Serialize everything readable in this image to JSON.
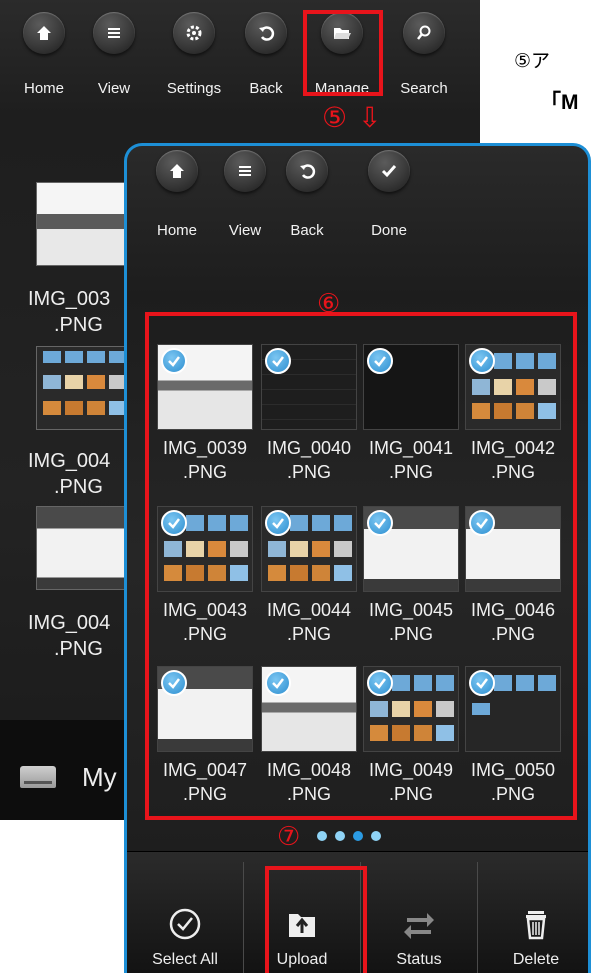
{
  "back_screen": {
    "toolbar": [
      {
        "label": "Home",
        "icon": "home-icon"
      },
      {
        "label": "View",
        "icon": "list-icon"
      },
      {
        "label": "Settings",
        "icon": "gear-icon"
      },
      {
        "label": "Back",
        "icon": "back-arrow-icon"
      },
      {
        "label": "Manage",
        "icon": "folder-open-icon"
      },
      {
        "label": "Search",
        "icon": "search-icon"
      }
    ],
    "files": [
      {
        "line1": "IMG_003",
        "line2": ".PNG"
      },
      {
        "line1": "IMG_004",
        "line2": ".PNG"
      },
      {
        "line1": "IMG_004",
        "line2": ".PNG"
      }
    ],
    "bottom_label": "My"
  },
  "annotations": {
    "right_line1": "⑤ア",
    "right_line2": "「M",
    "step5": "⑤",
    "step5_arrow": "⇩",
    "step6": "⑥",
    "step7": "⑦",
    "highlight_color": "#e8141b"
  },
  "front_screen": {
    "toolbar": [
      {
        "label": "Home",
        "icon": "home-icon"
      },
      {
        "label": "View",
        "icon": "list-icon"
      },
      {
        "label": "Back",
        "icon": "back-arrow-icon"
      },
      {
        "label": "Done",
        "icon": "checkmark-icon"
      }
    ],
    "files": [
      {
        "line1": "IMG_0039",
        "line2": ".PNG",
        "checked": true
      },
      {
        "line1": "IMG_0040",
        "line2": ".PNG",
        "checked": true
      },
      {
        "line1": "IMG_0041",
        "line2": ".PNG",
        "checked": true
      },
      {
        "line1": "IMG_0042",
        "line2": ".PNG",
        "checked": true
      },
      {
        "line1": "IMG_0043",
        "line2": ".PNG",
        "checked": true
      },
      {
        "line1": "IMG_0044",
        "line2": ".PNG",
        "checked": true
      },
      {
        "line1": "IMG_0045",
        "line2": ".PNG",
        "checked": true
      },
      {
        "line1": "IMG_0046",
        "line2": ".PNG",
        "checked": true
      },
      {
        "line1": "IMG_0047",
        "line2": ".PNG",
        "checked": true
      },
      {
        "line1": "IMG_0048",
        "line2": ".PNG",
        "checked": true
      },
      {
        "line1": "IMG_0049",
        "line2": ".PNG",
        "checked": true
      },
      {
        "line1": "IMG_0050",
        "line2": ".PNG",
        "checked": true
      }
    ],
    "pagination": {
      "pages": 4,
      "current": 3
    },
    "bottom_bar": [
      {
        "label": "Select All",
        "icon": "select-all-icon"
      },
      {
        "label": "Upload",
        "icon": "upload-icon"
      },
      {
        "label": "Status",
        "icon": "transfer-arrows-icon"
      },
      {
        "label": "Delete",
        "icon": "trash-icon"
      }
    ],
    "accent_color": "#1d8fd6"
  }
}
